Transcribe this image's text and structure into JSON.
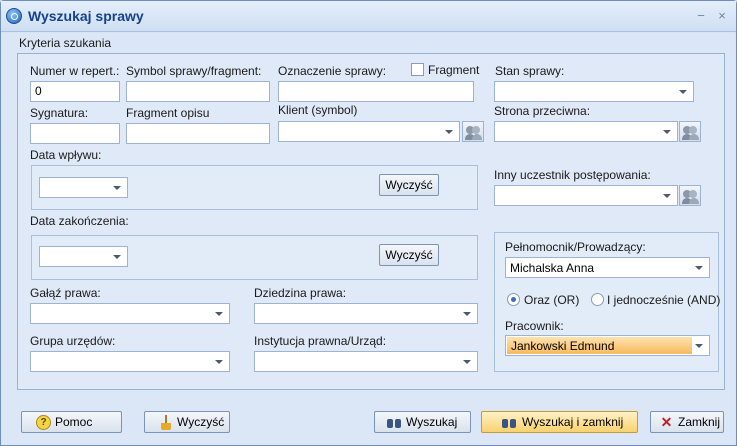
{
  "window": {
    "title": "Wyszukaj sprawy"
  },
  "criteria_label": "Kryteria szukania",
  "fields": {
    "numer_label": "Numer w repert.:",
    "numer_value": "0",
    "symbol_label": "Symbol sprawy/fragment:",
    "symbol_value": "",
    "oznaczenie_label": "Oznaczenie sprawy:",
    "oznaczenie_value": "",
    "fragment_checkbox_label": "Fragment",
    "fragment_checked": false,
    "stan_label": "Stan sprawy:",
    "stan_value": "",
    "sygnatura_label": "Sygnatura:",
    "sygnatura_value": "",
    "opis_label": "Fragment opisu",
    "opis_value": "",
    "klient_label": "Klient (symbol)",
    "klient_value": "",
    "strona_label": "Strona przeciwna:",
    "strona_value": "",
    "data_wplywu_label": "Data wpływu:",
    "data_wplywu_value": "",
    "data_zakonczenia_label": "Data zakończenia:",
    "data_zakonczenia_value": "",
    "inny_label": "Inny uczestnik postępowania:",
    "inny_value": "",
    "galaz_label": "Gałąź prawa:",
    "galaz_value": "",
    "dziedzina_label": "Dziedzina prawa:",
    "dziedzina_value": "",
    "grupa_label": "Grupa urzędów:",
    "grupa_value": "",
    "instytucja_label": "Instytucja prawna/Urząd:",
    "instytucja_value": "",
    "clear_button": "Wyczyść"
  },
  "right_panel": {
    "pelnomocnik_label": "Pełnomocnik/Prowadzący:",
    "pelnomocnik_value": "Michalska Anna",
    "radio_or_label": "Oraz (OR)",
    "radio_and_label": "I jednocześnie (AND)",
    "radio_selected": "or",
    "pracownik_label": "Pracownik:",
    "pracownik_value": "Jankowski Edmund"
  },
  "footer": {
    "help": "Pomoc",
    "clear": "Wyczyść",
    "search": "Wyszukaj",
    "search_close": "Wyszukaj i zamknij",
    "close": "Zamknij"
  },
  "colors": {
    "accent": "#15428b",
    "highlight": "#f7b95d"
  }
}
